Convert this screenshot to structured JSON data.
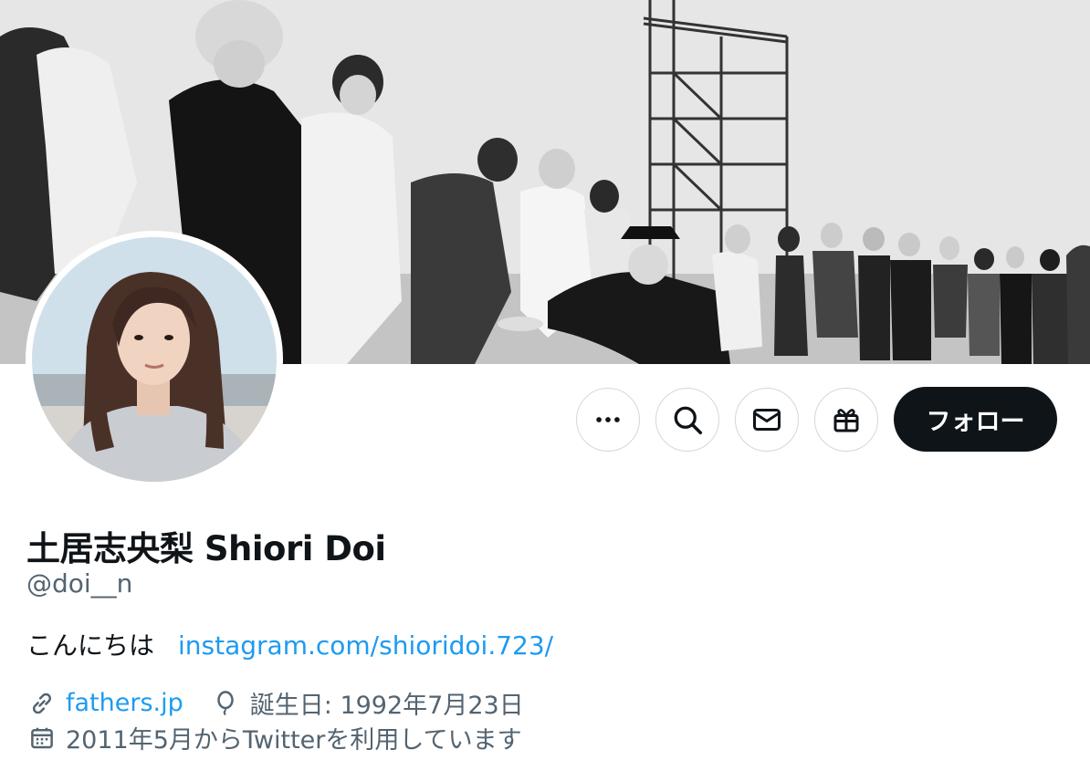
{
  "profile": {
    "display_name": "土居志央梨 Shiori Doi",
    "handle": "@doi__n",
    "bio_text": "こんにちは",
    "bio_link": "instagram.com/shioridoi.723/",
    "website": "fathers.jp",
    "birthday": "誕生日: 1992年7月23日",
    "joined": "2011年5月からTwitterを利用しています"
  },
  "actions": {
    "more_icon": "more-icon",
    "search_icon": "search-icon",
    "message_icon": "mail-icon",
    "gift_icon": "gift-icon",
    "follow_label": "フォロー"
  },
  "colors": {
    "link": "#1d9bf0",
    "secondary_text": "#536471",
    "follow_button_bg": "#0f1419",
    "border": "#cfd9de"
  },
  "icons": {
    "website": "link-icon",
    "birthday": "balloon-icon",
    "joined": "calendar-icon"
  }
}
